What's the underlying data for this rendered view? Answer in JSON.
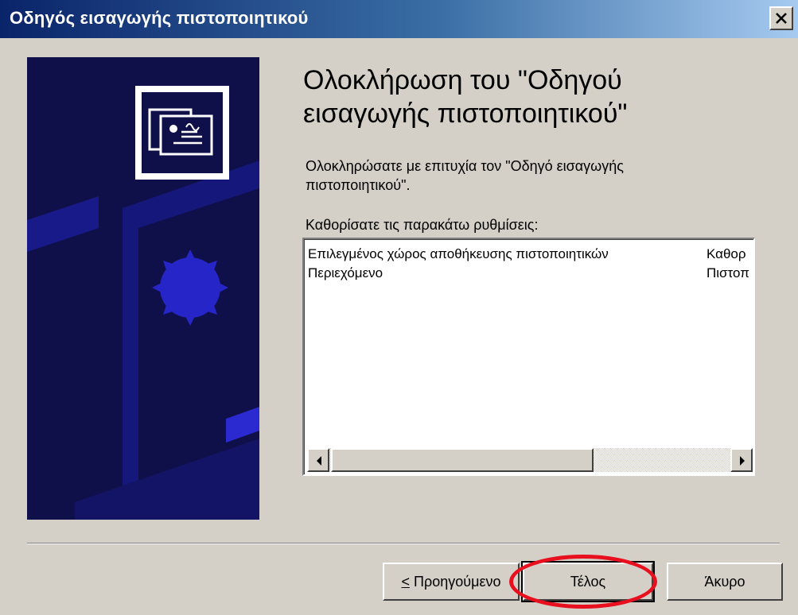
{
  "window": {
    "title": "Οδηγός εισαγωγής πιστοποιητικού",
    "close_icon": "close-icon"
  },
  "side_panel": {
    "icon": "certificate-icon",
    "colors": {
      "background": "#0f1049",
      "accent": "#1a1aa6"
    }
  },
  "main": {
    "heading": "Ολοκλήρωση του \"Οδηγού εισαγωγής πιστοποιητικού\"",
    "description": "Ολοκληρώσατε με επιτυχία τον \"Οδηγό εισαγωγής πιστοποιητικού\".",
    "settings_label": "Καθορίσατε τις παρακάτω ρυθμίσεις:",
    "settings": [
      {
        "name": "Επιλεγμένος χώρος αποθήκευσης πιστοποιητικών",
        "value": "Καθορ"
      },
      {
        "name": "Περιεχόμενο",
        "value": "Πιστοπ"
      }
    ]
  },
  "buttons": {
    "back": "< Προηγούμενο",
    "finish": "Τέλος",
    "cancel": "Άκυρο"
  },
  "highlight_color": "#e8101f"
}
